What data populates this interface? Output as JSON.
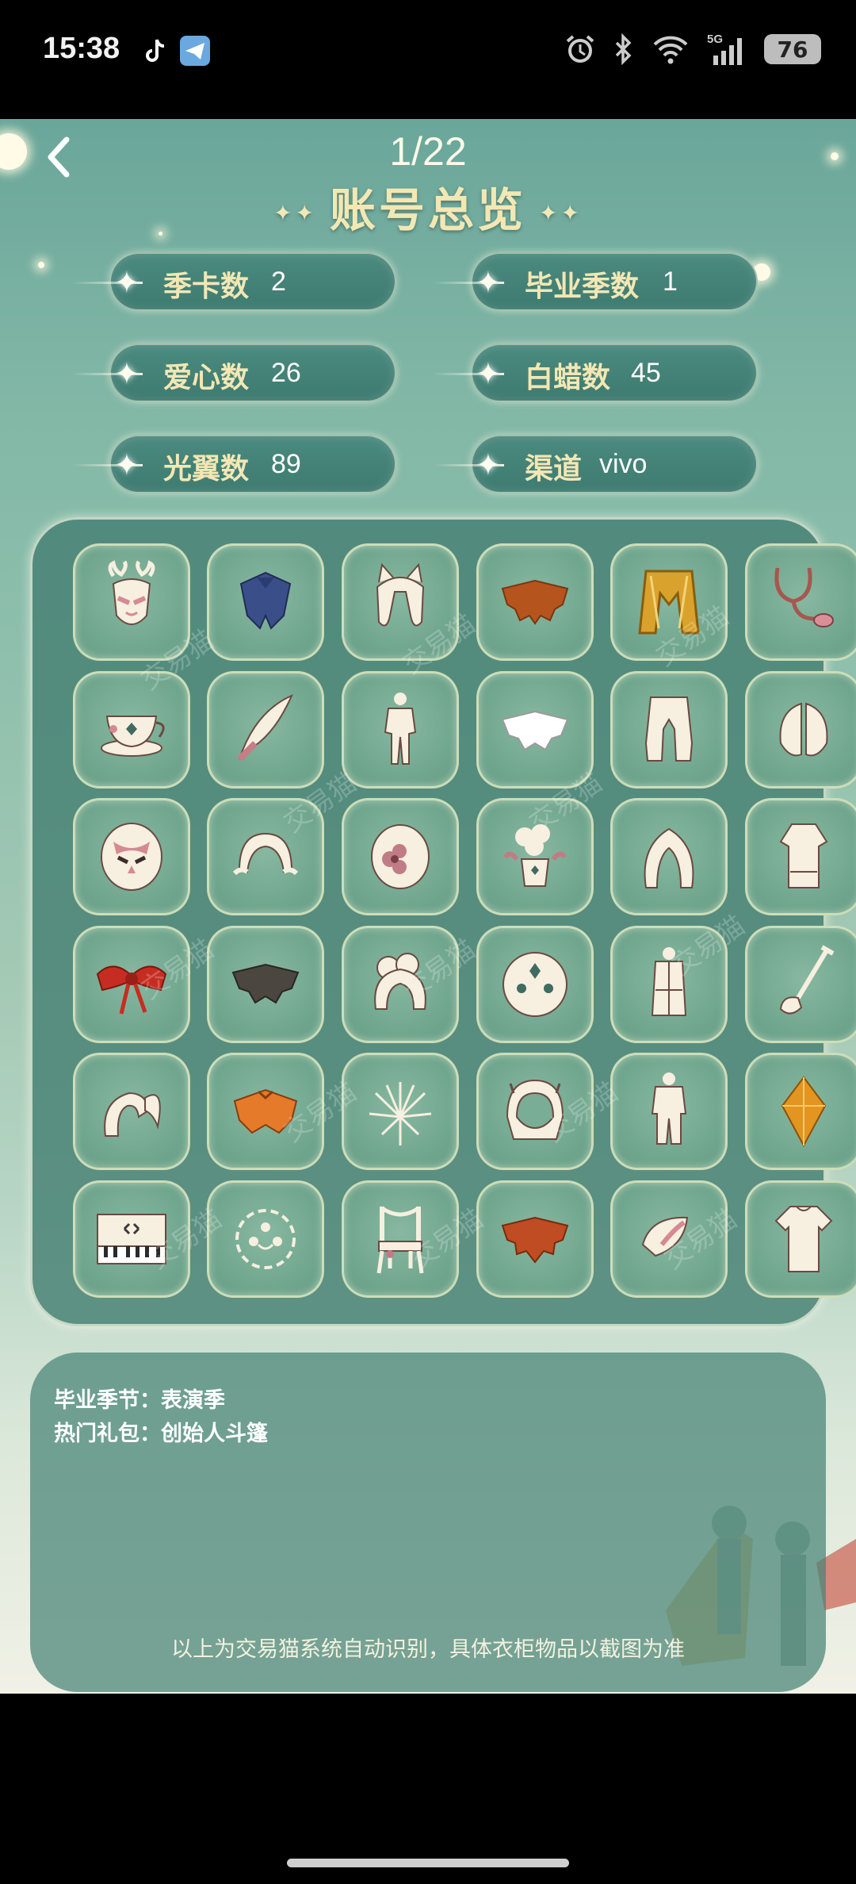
{
  "status_bar": {
    "time": "15:38",
    "app_icons": [
      "tiktok-icon",
      "telegram-icon"
    ],
    "right_icons": [
      "alarm-icon",
      "bluetooth-icon",
      "wifi-icon",
      "cellular-5g-icon"
    ],
    "network": "5G",
    "battery": "76"
  },
  "header": {
    "page_counter": "1/22",
    "title": "账号总览"
  },
  "stats": [
    {
      "label": "季卡数",
      "value": "2"
    },
    {
      "label": "毕业季数",
      "value": "1"
    },
    {
      "label": "爱心数",
      "value": "26"
    },
    {
      "label": "白蜡数",
      "value": "45"
    },
    {
      "label": "光翼数",
      "value": "89"
    },
    {
      "label": "渠道",
      "value": "vivo"
    }
  ],
  "inventory": [
    "antler-mask-icon",
    "blue-cape-icon",
    "horn-hair-icon",
    "orange-cape-icon",
    "golden-cape-icon",
    "stethoscope-icon",
    "teacup-icon",
    "feather-icon",
    "outfit-icon",
    "white-cape-icon",
    "pants-icon",
    "wing-cape-icon",
    "owl-mask-icon",
    "bun-hair-icon",
    "flower-mask-icon",
    "flower-pot-icon",
    "long-hair-icon",
    "robe-icon",
    "red-bow-icon",
    "dark-cape-icon",
    "curly-hair-icon",
    "round-mask-icon",
    "coat-icon",
    "shovel-icon",
    "ponytail-hair-icon",
    "orange-cape-bow-icon",
    "firework-icon",
    "hood-icon",
    "suit-icon",
    "amber-crystal-icon",
    "piano-icon",
    "circle-emote-icon",
    "chair-icon",
    "red-maple-cape-icon",
    "petal-icon",
    "shirt-icon"
  ],
  "watermark": "交易猫",
  "info": {
    "graduation_label": "毕业季节：",
    "graduation_value": "表演季",
    "popular_label": "热门礼包：",
    "popular_value": "创始人斗篷",
    "disclaimer": "以上为交易猫系统自动识别，具体衣柜物品以截图为准"
  },
  "colors": {
    "title_gold": "#f3e7b4",
    "panel_teal": "#46807a",
    "cell_green": "#7aad96"
  }
}
